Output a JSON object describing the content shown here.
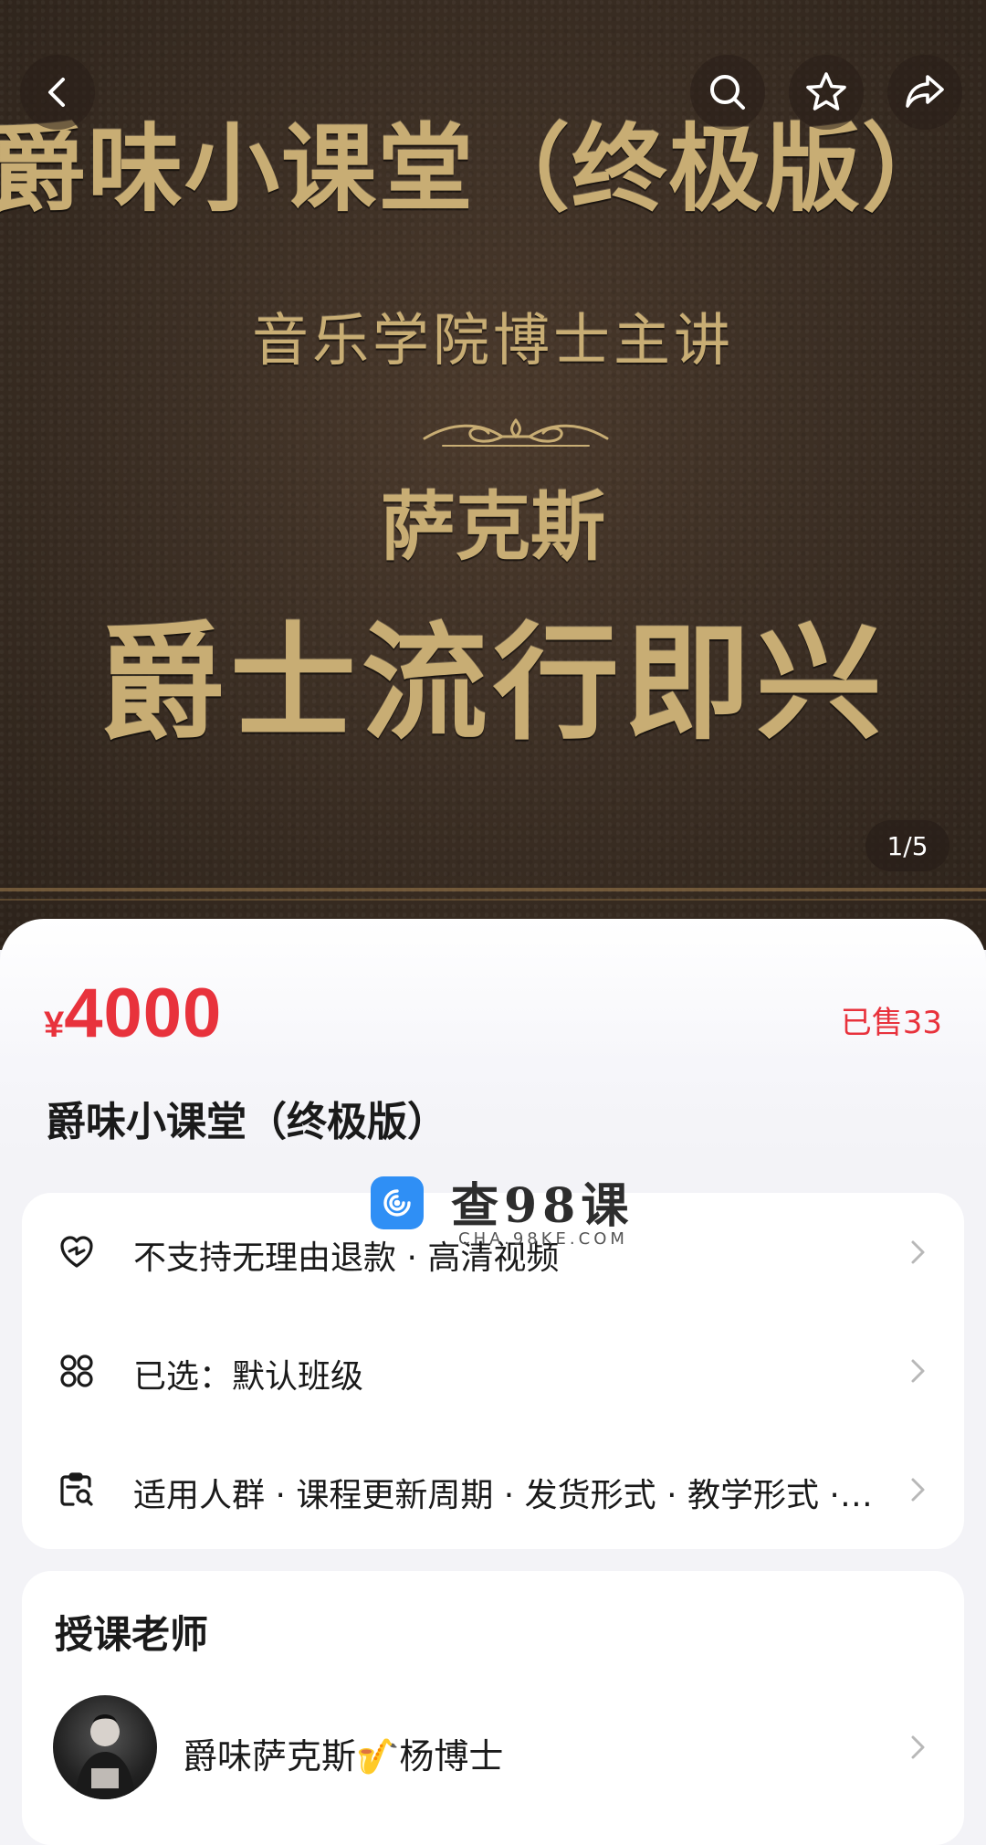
{
  "hero": {
    "title": "爵味小课堂（终极版）",
    "subtitle": "音乐学院博士主讲",
    "instrument": "萨克斯",
    "headline": "爵士流行即兴",
    "image_counter": "1/5",
    "buttons": [
      "back-icon",
      "search-icon",
      "star-icon",
      "share-icon"
    ]
  },
  "product": {
    "currency": "¥",
    "price": "4000",
    "sold": "已售33",
    "title": "爵味小课堂（终极版）"
  },
  "watermark": {
    "text": "查98课",
    "sub": "CHA.98KE.COM"
  },
  "info_rows": [
    {
      "icon": "heart-shield-icon",
      "text": "不支持无理由退款 · 高清视频"
    },
    {
      "icon": "grid-icon",
      "text": "已选：默认班级"
    },
    {
      "icon": "clipboard-search-icon",
      "text": "适用人群 · 课程更新周期 · 发货形式 · 教学形式 · 课程服务"
    }
  ],
  "teacher_section": {
    "title": "授课老师",
    "name": "爵味萨克斯🎷杨博士"
  },
  "colors": {
    "accent": "#e8323c",
    "gold": "#c8ad74",
    "hero_bg": "#3c2f24"
  }
}
